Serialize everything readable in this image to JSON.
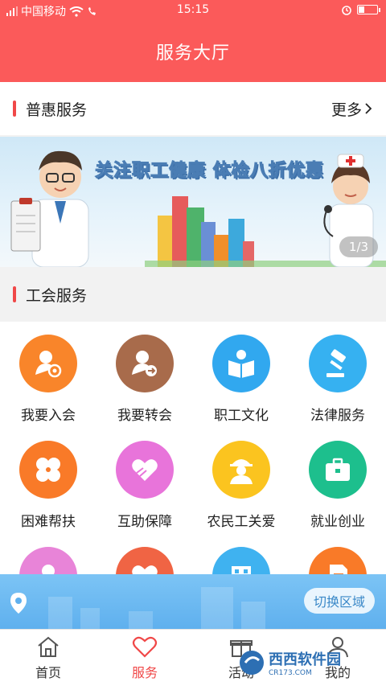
{
  "status_bar": {
    "carrier": "中国移动",
    "time": "15:15"
  },
  "header": {
    "title": "服务大厅"
  },
  "section_welfare": {
    "label": "普惠服务",
    "more": "更多"
  },
  "banner": {
    "headline": "关注职工健康 体检八折优惠",
    "pager": "1/3"
  },
  "section_union": {
    "label": "工会服务"
  },
  "services": [
    {
      "name": "我要入会",
      "icon": "badge-user-icon",
      "color": "#f9852a"
    },
    {
      "name": "我要转会",
      "icon": "user-transfer-icon",
      "color": "#a86b4b"
    },
    {
      "name": "职工文化",
      "icon": "reading-icon",
      "color": "#31a8ef"
    },
    {
      "name": "法律服务",
      "icon": "gavel-icon",
      "color": "#36b1f1"
    },
    {
      "name": "困难帮扶",
      "icon": "clover-icon",
      "color": "#f97a28"
    },
    {
      "name": "互助保障",
      "icon": "heart-hands-icon",
      "color": "#e874da"
    },
    {
      "name": "农民工关爱",
      "icon": "worker-icon",
      "color": "#fbc41f"
    },
    {
      "name": "就业创业",
      "icon": "briefcase-icon",
      "color": "#1dbf8d"
    },
    {
      "name": "",
      "icon": "woman-icon",
      "color": "#e884d8"
    },
    {
      "name": "",
      "icon": "heart-icon",
      "color": "#f06444"
    },
    {
      "name": "",
      "icon": "building-icon",
      "color": "#3fb2f0"
    },
    {
      "name": "",
      "icon": "document-icon",
      "color": "#f97a28"
    }
  ],
  "location_bar": {
    "switch_label": "切换区域"
  },
  "tabs": [
    {
      "label": "首页",
      "icon": "home-icon"
    },
    {
      "label": "服务",
      "icon": "heart-outline-icon",
      "active": true
    },
    {
      "label": "活动",
      "icon": "gift-icon"
    },
    {
      "label": "我的",
      "icon": "profile-icon"
    }
  ],
  "watermark": {
    "text": "西西软件园",
    "sub": "CR173.COM"
  }
}
